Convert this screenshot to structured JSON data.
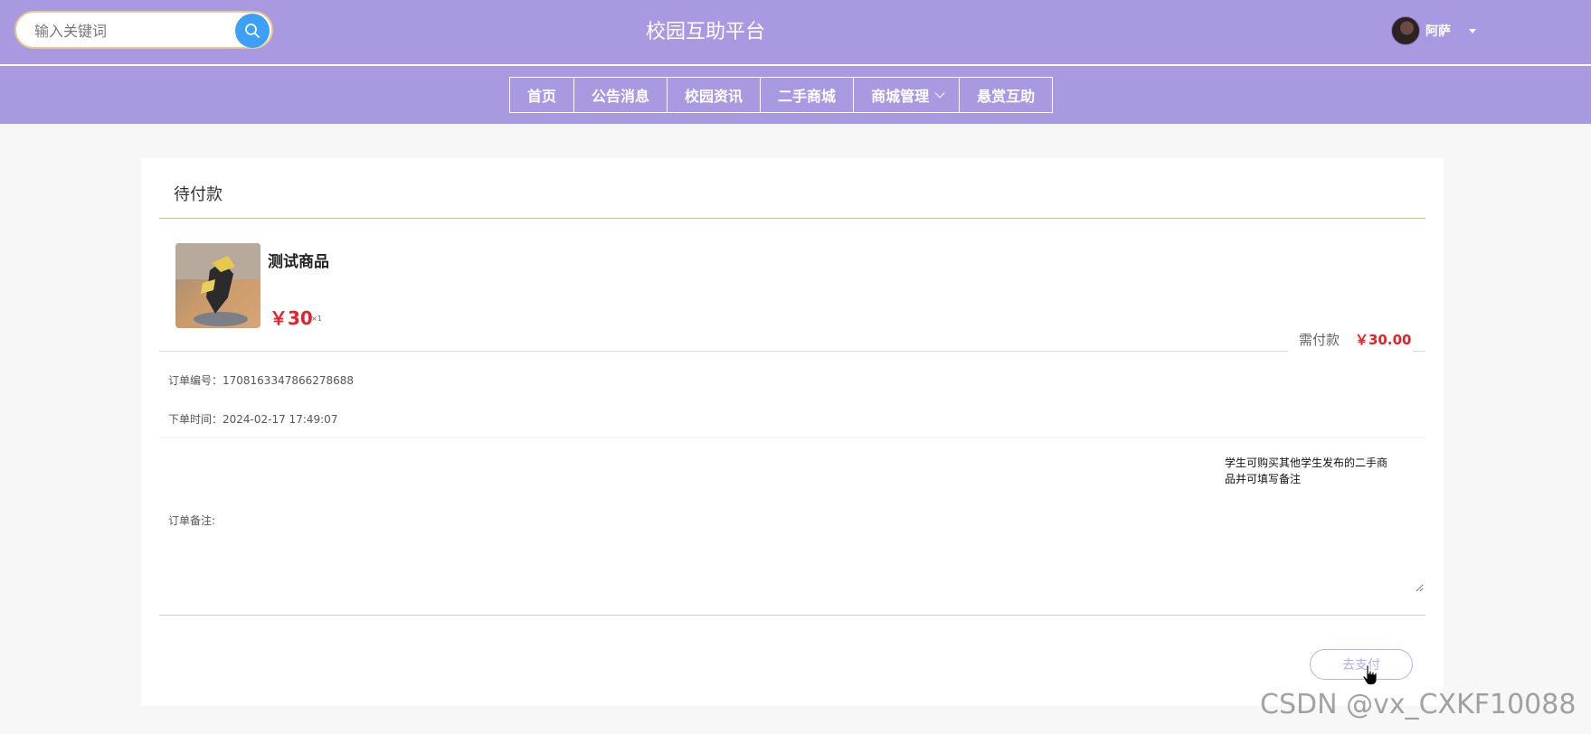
{
  "header": {
    "search_placeholder": "输入关键词",
    "site_title": "校园互助平台",
    "username": "阿萨"
  },
  "nav": {
    "items": [
      {
        "label": "首页"
      },
      {
        "label": "公告消息"
      },
      {
        "label": "校园资讯"
      },
      {
        "label": "二手商城"
      },
      {
        "label": "商城管理"
      },
      {
        "label": "悬赏互助"
      }
    ]
  },
  "order": {
    "status_title": "待付款",
    "product_name": "测试商品",
    "price": "￥30",
    "quantity": "×1",
    "pay_due_label": "需付款",
    "pay_due_amount": "￥30.00",
    "order_no": "订单编号：1708163347866278688",
    "order_time": "下单时间：2024-02-17 17:49:07",
    "remark_label": "订单备注:",
    "remark_value": "学生可购买其他学生发布的二手商品并可填写备注",
    "pay_button": "去支付"
  },
  "watermark": "CSDN @vx_CXKF10088",
  "colors": {
    "header_bg": "#a899e0",
    "price_red": "#e5202a",
    "search_blue": "#3d9ff5",
    "accent_gold": "#d9bf7a"
  }
}
